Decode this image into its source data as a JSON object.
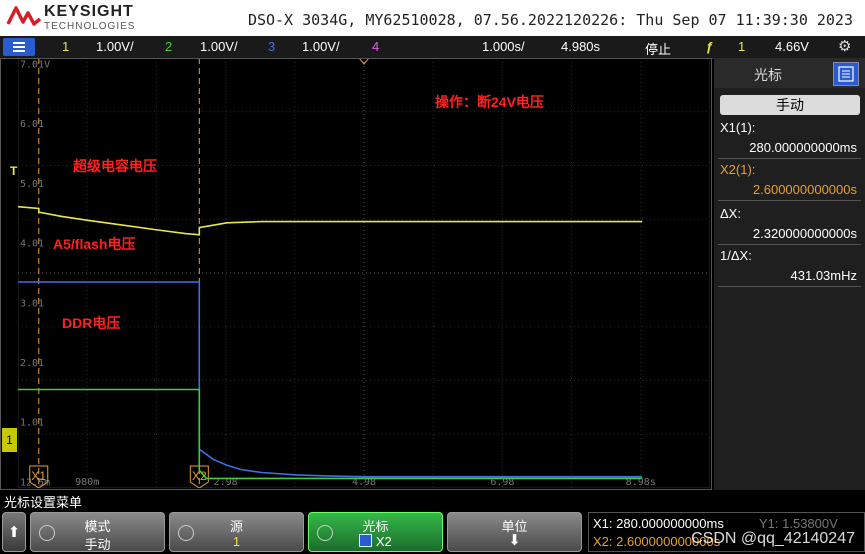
{
  "header": {
    "brand": "KEYSIGHT",
    "brand_sub": "TECHNOLOGIES",
    "device_info": "DSO-X 3034G, MY62510028, 07.56.2022120226: Thu Sep 07 11:39:30 2023"
  },
  "channel_bar": {
    "ch1_num": "1",
    "ch1_scale": "1.00V/",
    "ch2_num": "2",
    "ch2_scale": "1.00V/",
    "ch3_num": "3",
    "ch3_scale": "1.00V/",
    "ch4_num": "4",
    "timebase": "1.000s/",
    "delay": "4.980s",
    "run_state": "停止",
    "trig_source": "1",
    "trig_level": "4.66V"
  },
  "plot": {
    "y_labels": [
      "7.01V",
      "6.01",
      "5.01",
      "4.01",
      "3.01",
      "2.01",
      "1.01",
      "12.5m"
    ],
    "x_labels": [
      "980m",
      "2.98",
      "4.98",
      "6.98",
      "8.98s"
    ],
    "cursor_x1_label": "X1",
    "cursor_x2_label": "X2",
    "trigger_marker": "T",
    "ground_marker": "1",
    "annotations": {
      "operation": "操作：断24V电压",
      "supercap": "超级电容电压",
      "a5flash": "A5/flash电压",
      "ddr": "DDR电压"
    }
  },
  "chart_data": {
    "type": "line",
    "x_ticks": [
      0.98,
      2.98,
      4.98,
      6.98,
      8.98
    ],
    "xlim": [
      -0.02,
      9.98
    ],
    "ylim": [
      -0.1,
      7.1
    ],
    "x_unit": "s",
    "y_unit": "V",
    "cursor_x1": 0.28,
    "cursor_x2": 2.6,
    "series": [
      {
        "name": "超级电容电压",
        "color": "#e8e84a",
        "x": [
          -0.02,
          0.28,
          0.28,
          0.6,
          1.0,
          1.5,
          2.0,
          2.4,
          2.6,
          2.6,
          3.0,
          3.5,
          9.0
        ],
        "y": [
          4.61,
          4.58,
          4.52,
          4.45,
          4.38,
          4.3,
          4.22,
          4.16,
          4.14,
          4.26,
          4.34,
          4.36,
          4.36
        ]
      },
      {
        "name": "A5/flash电压",
        "color": "#3f6fe8",
        "x": [
          -0.02,
          2.6,
          2.6,
          2.8,
          3.0,
          3.2,
          3.5,
          4.0,
          4.5,
          5.0,
          9.0
        ],
        "y": [
          3.35,
          3.35,
          0.55,
          0.38,
          0.28,
          0.21,
          0.16,
          0.12,
          0.1,
          0.09,
          0.09
        ]
      },
      {
        "name": "DDR电压",
        "color": "#3ccf3c",
        "x": [
          -0.02,
          2.6,
          2.6,
          2.7,
          9.0
        ],
        "y": [
          1.55,
          1.55,
          0.2,
          0.06,
          0.06
        ]
      }
    ]
  },
  "panel": {
    "title": "光标",
    "mode_button": "手动",
    "x1_label": "X1(1):",
    "x1_value": "280.000000000ms",
    "x2_label": "X2(1):",
    "x2_value": "2.600000000000s",
    "dx_label": "ΔX:",
    "dx_value": "2.320000000000s",
    "inv_dx_label": "1/ΔX:",
    "inv_dx_value": "431.03mHz"
  },
  "menu": {
    "title": "光标设置菜单"
  },
  "softkeys": {
    "mode_title": "模式",
    "mode_value": "手动",
    "source_title": "源",
    "source_value": "1",
    "cursor_title": "光标",
    "cursor_value": "X2",
    "unit_title": "单位"
  },
  "readout": {
    "x1": "X1: 280.000000000ms",
    "x2": "X2: 2.600000000000s",
    "y1": "Y1: 1.53800V"
  },
  "watermark": "CSDN @qq_42140247",
  "colors": {
    "ch1": "#e8e84a",
    "ch2": "#3ccf3c",
    "ch3": "#3f6fe8",
    "ch4": "#e060e0",
    "annotation": "#ff2020",
    "cursor": "#e8a030",
    "accent": "#2a5bd0"
  }
}
